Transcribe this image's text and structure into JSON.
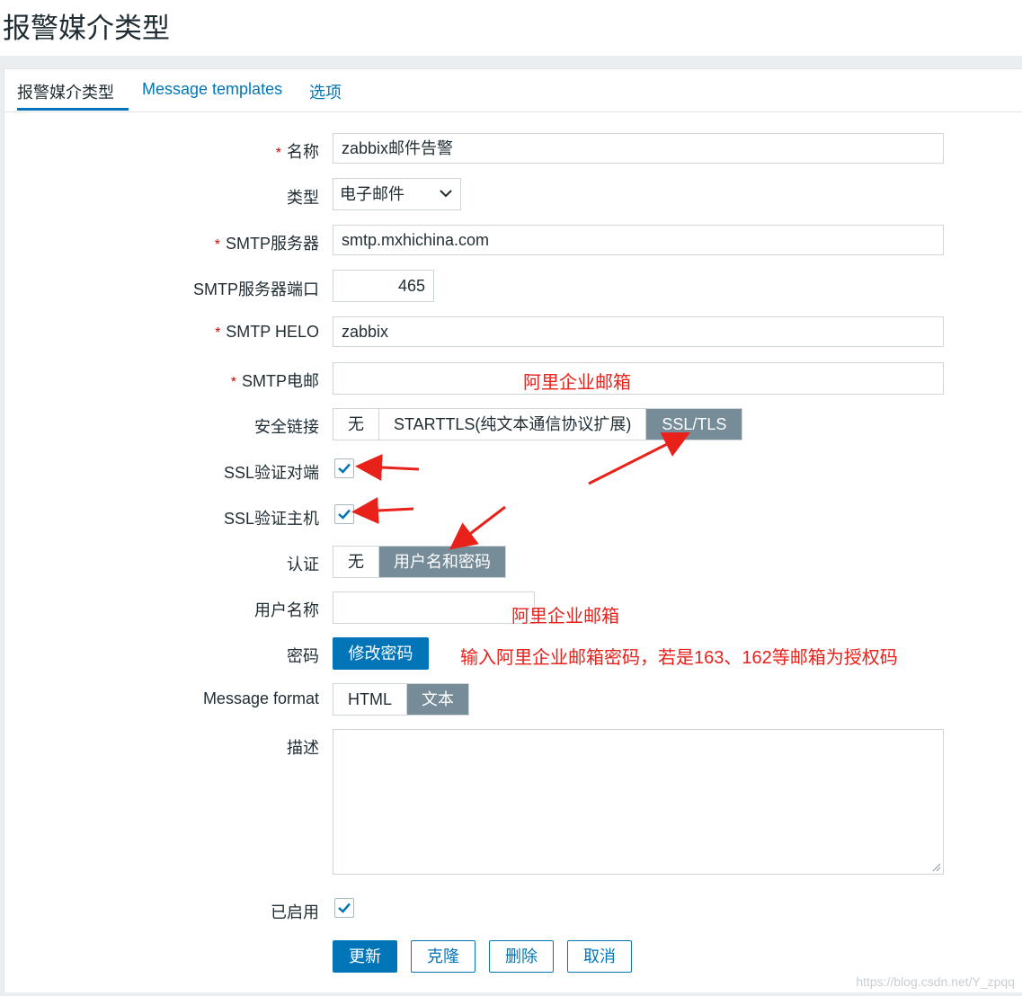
{
  "page": {
    "title": "报警媒介类型"
  },
  "tabs": [
    {
      "label": "报警媒介类型"
    },
    {
      "label": "Message templates"
    },
    {
      "label": "选项"
    }
  ],
  "form": {
    "name": {
      "label": "名称",
      "value": "zabbix邮件告警"
    },
    "type": {
      "label": "类型",
      "value": "电子邮件"
    },
    "smtp_server": {
      "label": "SMTP服务器",
      "value": "smtp.mxhichina.com"
    },
    "smtp_port": {
      "label": "SMTP服务器端口",
      "value": "465"
    },
    "smtp_helo": {
      "label": "SMTP HELO",
      "value": "zabbix"
    },
    "smtp_email": {
      "label": "SMTP电邮",
      "value": ""
    },
    "security": {
      "label": "安全链接",
      "options": [
        "无",
        "STARTTLS(纯文本通信协议扩展)",
        "SSL/TLS"
      ],
      "selected": "SSL/TLS"
    },
    "ssl_verify_peer": {
      "label": "SSL验证对端",
      "checked": true
    },
    "ssl_verify_host": {
      "label": "SSL验证主机",
      "checked": true
    },
    "auth": {
      "label": "认证",
      "options": [
        "无",
        "用户名和密码"
      ],
      "selected": "用户名和密码"
    },
    "username": {
      "label": "用户名称",
      "value": ""
    },
    "password": {
      "label": "密码",
      "button": "修改密码"
    },
    "message_format": {
      "label": "Message format",
      "options": [
        "HTML",
        "文本"
      ],
      "selected": "文本"
    },
    "description": {
      "label": "描述",
      "value": ""
    },
    "enabled": {
      "label": "已启用",
      "checked": true
    }
  },
  "buttons": {
    "update": "更新",
    "clone": "克隆",
    "delete": "删除",
    "cancel": "取消"
  },
  "annotations": {
    "email_note": "阿里企业邮箱",
    "user_note": "阿里企业邮箱",
    "password_note": "输入阿里企业邮箱密码，若是163、162等邮箱为授权码"
  },
  "watermark": "https://blog.csdn.net/Y_zpqq",
  "colors": {
    "accent": "#0275b8",
    "selected_segment": "#768d99",
    "annotation": "#e8211b",
    "required": "#d40000"
  }
}
